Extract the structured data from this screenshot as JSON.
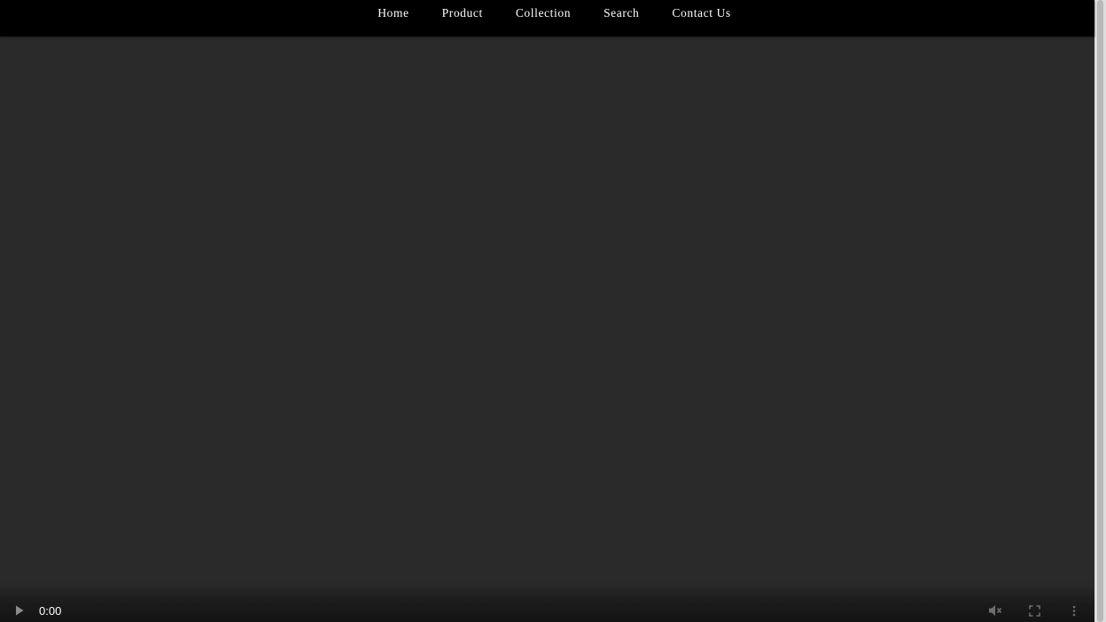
{
  "nav": {
    "items": [
      {
        "label": "Home"
      },
      {
        "label": "Product"
      },
      {
        "label": "Collection"
      },
      {
        "label": "Search"
      },
      {
        "label": "Contact Us"
      }
    ]
  },
  "video": {
    "current_time": "0:00",
    "icons": {
      "play": "play-icon",
      "mute": "volume-muted-icon",
      "fullscreen": "fullscreen-icon",
      "more": "more-vertical-icon"
    }
  },
  "colors": {
    "nav_background": "#000000",
    "page_background": "#2a2a2a",
    "nav_text": "#ffffff"
  }
}
